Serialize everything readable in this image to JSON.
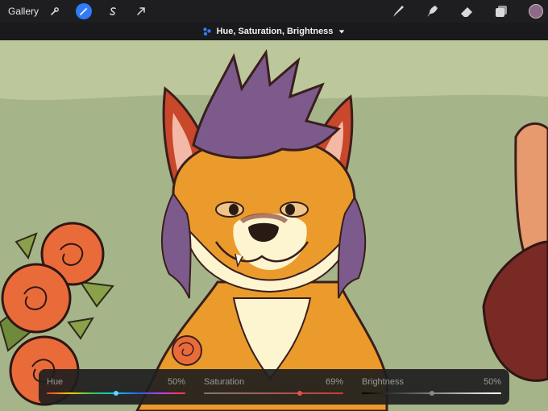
{
  "toolbar": {
    "gallery_label": "Gallery",
    "left_tools": [
      "wrench-icon",
      "magic-wand-icon",
      "selection-s-icon",
      "transform-arrow-icon"
    ],
    "active_tool": "magic-wand-icon",
    "right_tools": [
      "brush-icon",
      "smudge-icon",
      "eraser-icon",
      "layers-icon"
    ],
    "current_color": "#8e6a86"
  },
  "adjustment": {
    "title": "Hue, Saturation, Brightness",
    "accent": "#2f7cf6"
  },
  "sliders": [
    {
      "label": "Hue",
      "value_text": "50%",
      "value": 0.5,
      "knob_color": "#66d1ff"
    },
    {
      "label": "Saturation",
      "value_text": "69%",
      "value": 0.69,
      "knob_color": "#e0524f"
    },
    {
      "label": "Brightness",
      "value_text": "50%",
      "value": 0.5,
      "knob_color": "#8a8a8a"
    }
  ]
}
